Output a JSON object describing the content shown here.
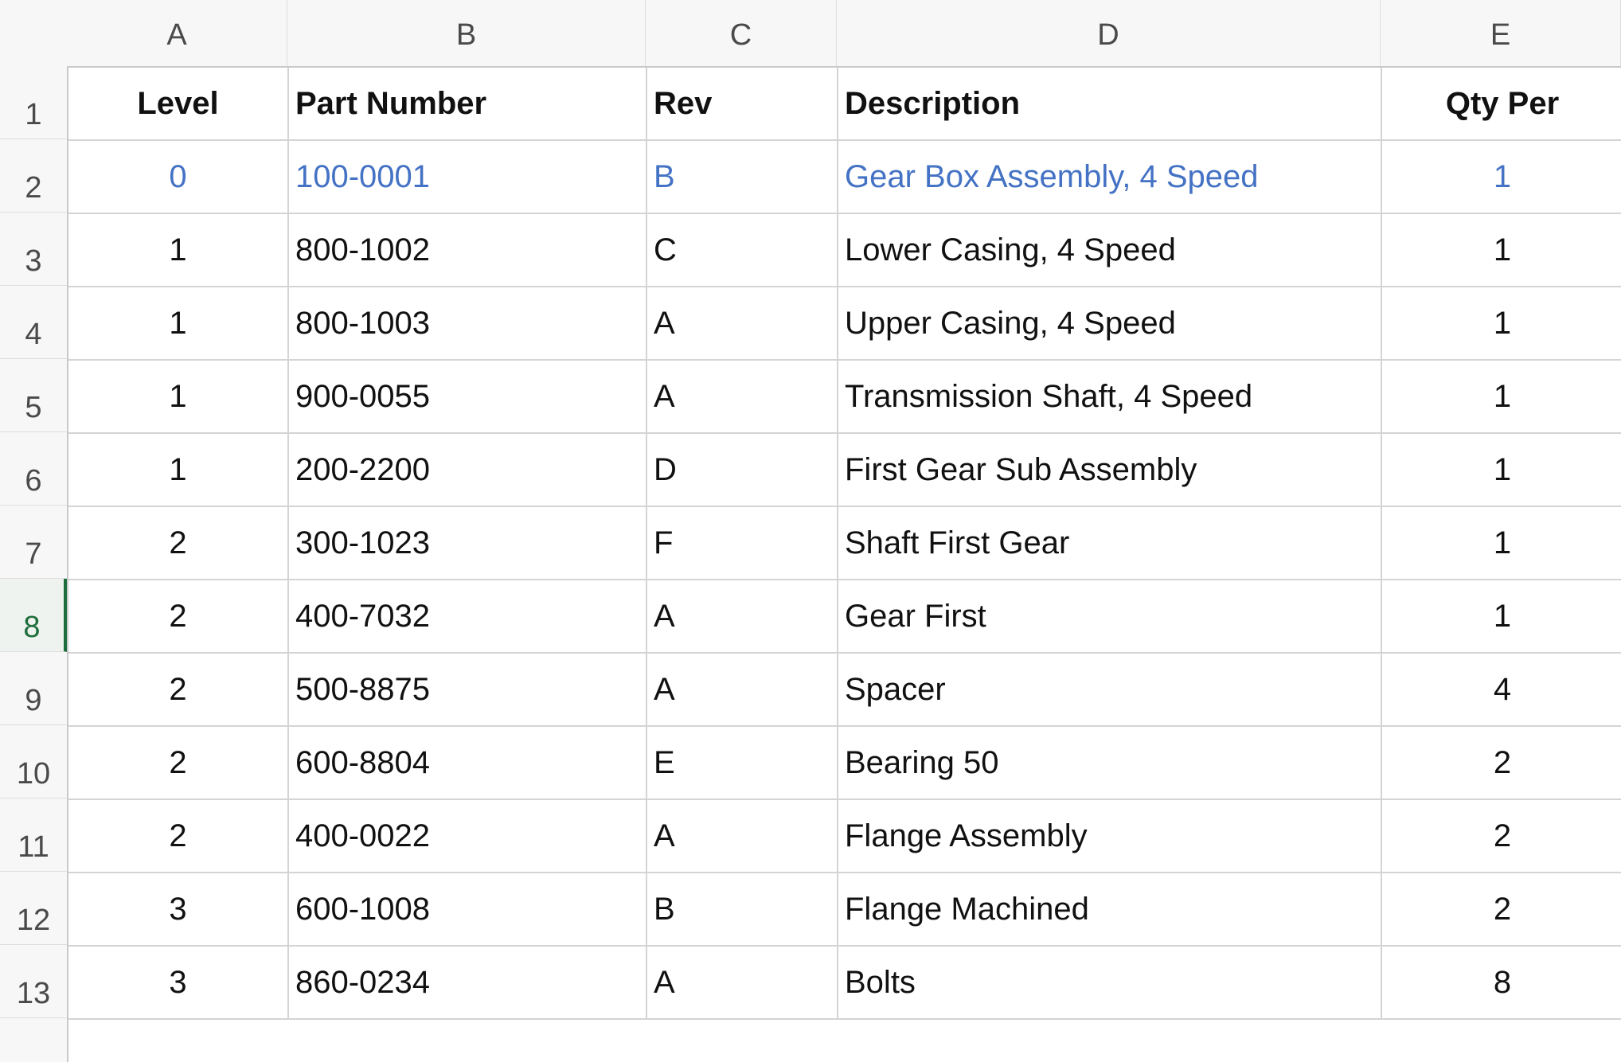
{
  "columns": [
    "A",
    "B",
    "C",
    "D",
    "E"
  ],
  "row_numbers": [
    "1",
    "2",
    "3",
    "4",
    "5",
    "6",
    "7",
    "8",
    "9",
    "10",
    "11",
    "12",
    "13"
  ],
  "active_row": "8",
  "colors": {
    "highlight_text": "#4472c4",
    "active_row_header": "#1e6e3c"
  },
  "table": {
    "headers": [
      "Level",
      "Part Number",
      "Rev",
      "Description",
      "Qty Per"
    ],
    "rows": [
      [
        "0",
        "100-0001",
        "B",
        "Gear Box Assembly, 4 Speed",
        "1"
      ],
      [
        "1",
        "800-1002",
        "C",
        "Lower Casing, 4 Speed",
        "1"
      ],
      [
        "1",
        "800-1003",
        "A",
        "Upper Casing, 4 Speed",
        "1"
      ],
      [
        "1",
        "900-0055",
        "A",
        "Transmission Shaft, 4 Speed",
        "1"
      ],
      [
        "1",
        "200-2200",
        "D",
        "First Gear Sub Assembly",
        "1"
      ],
      [
        "2",
        "300-1023",
        "F",
        "Shaft First Gear",
        "1"
      ],
      [
        "2",
        "400-7032",
        "A",
        "Gear First",
        "1"
      ],
      [
        "2",
        "500-8875",
        "A",
        "Spacer",
        "4"
      ],
      [
        "2",
        "600-8804",
        "E",
        "Bearing 50",
        "2"
      ],
      [
        "2",
        "400-0022",
        "A",
        "Flange Assembly",
        "2"
      ],
      [
        "3",
        "600-1008",
        "B",
        "Flange Machined",
        "2"
      ],
      [
        "3",
        "860-0234",
        "A",
        "Bolts",
        "8"
      ]
    ]
  }
}
